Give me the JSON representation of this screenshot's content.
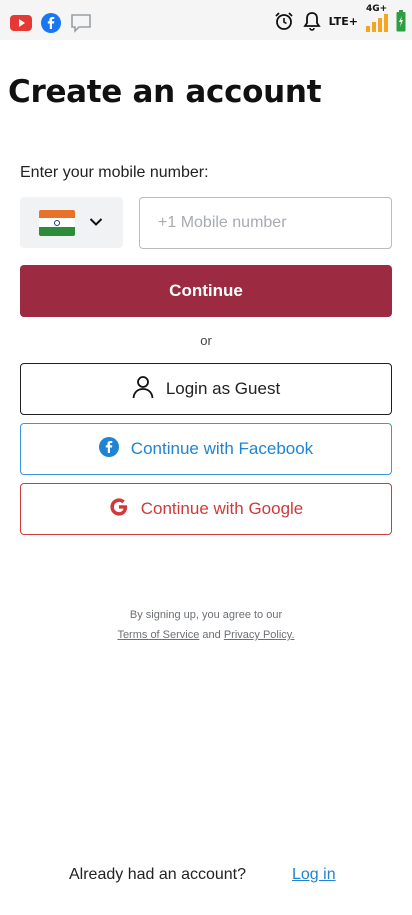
{
  "status_bar": {
    "left_icons": [
      "youtube-icon",
      "facebook-icon",
      "message-icon"
    ],
    "right_icons": [
      "alarm-icon",
      "bell-icon",
      "signal-icon",
      "battery-icon"
    ],
    "network_lte": "LTE+",
    "network_4g": "4G+",
    "colors": {
      "youtube": "#e53935",
      "facebook": "#1877f2",
      "signal": "#f2a623",
      "battery": "#2e9e44"
    }
  },
  "page": {
    "title": "Create an account"
  },
  "phone": {
    "label": "Enter your mobile number:",
    "country_icon": "india-flag-icon",
    "placeholder": "+1 Mobile number",
    "value": ""
  },
  "buttons": {
    "continue": "Continue",
    "or": "or",
    "guest": "Login as Guest",
    "facebook": "Continue with Facebook",
    "google": "Continue with Google"
  },
  "legal": {
    "intro": "By signing up, you agree to our",
    "terms": "Terms of Service",
    "and": "and",
    "privacy": "Privacy Policy."
  },
  "footer": {
    "question": "Already had an account?",
    "login": "Log in"
  },
  "colors": {
    "primary": "#9c2a40",
    "facebook_blue": "#1f84d2",
    "google_red": "#d03a3a"
  }
}
